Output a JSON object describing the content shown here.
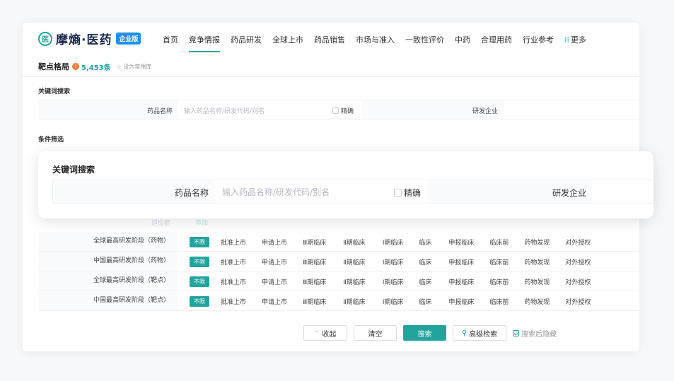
{
  "brand": {
    "name": "摩熵·医药",
    "badge": "企业版",
    "mark": "医"
  },
  "nav": {
    "items": [
      "首页",
      "竞争情报",
      "药品研发",
      "全球上市",
      "药品销售",
      "市场与准入",
      "一致性评价",
      "中药",
      "合理用药",
      "行业参考"
    ],
    "active_index": 1,
    "more_label": "更多",
    "more_icon": "⁞⁞"
  },
  "subheader": {
    "title": "靶点格局",
    "info_icon": "!",
    "count": "5,453条",
    "star_icon": "☆",
    "favorite_label": "设为常用库"
  },
  "keyword_section": {
    "title": "关键词搜索",
    "drug_name_label": "药品名称",
    "drug_name_placeholder": "输入药品名称/研发代码/别名",
    "exact_label": "精确",
    "company_label": "研发企业"
  },
  "filter_section": {
    "title": "条件筛选",
    "faded_left": "适应症",
    "faded_right": "添加"
  },
  "phase_rows": [
    {
      "label": "全球最高研发阶段（药物）",
      "tag": "不限"
    },
    {
      "label": "中国最高研发阶段（药物）",
      "tag": "不限"
    },
    {
      "label": "全球最高研发阶段（靶点）",
      "tag": "不限"
    },
    {
      "label": "中国最高研发阶段（靶点）",
      "tag": "不限"
    }
  ],
  "phase_options": [
    "批准上市",
    "申请上市",
    "Ⅲ期临床",
    "Ⅱ期临床",
    "Ⅰ期临床",
    "临床",
    "申报临床",
    "临床前",
    "药物发现",
    "对外授权"
  ],
  "actions": {
    "collapse_icon": "⌃",
    "collapse_label": "收起",
    "clear_label": "清空",
    "search_label": "搜索",
    "advanced_icon": "⚲",
    "advanced_label": "高级检索",
    "hide_after_label": "搜索后隐藏"
  },
  "popup": {
    "title": "关键词搜索",
    "drug_name_label": "药品名称",
    "drug_name_placeholder": "输入药品名称/研发代码/别名",
    "exact_label": "精确",
    "company_label": "研发企业"
  },
  "colors": {
    "accent": "#22a39c",
    "brand_badge": "#1f8ff0",
    "info": "#f27b3a"
  }
}
